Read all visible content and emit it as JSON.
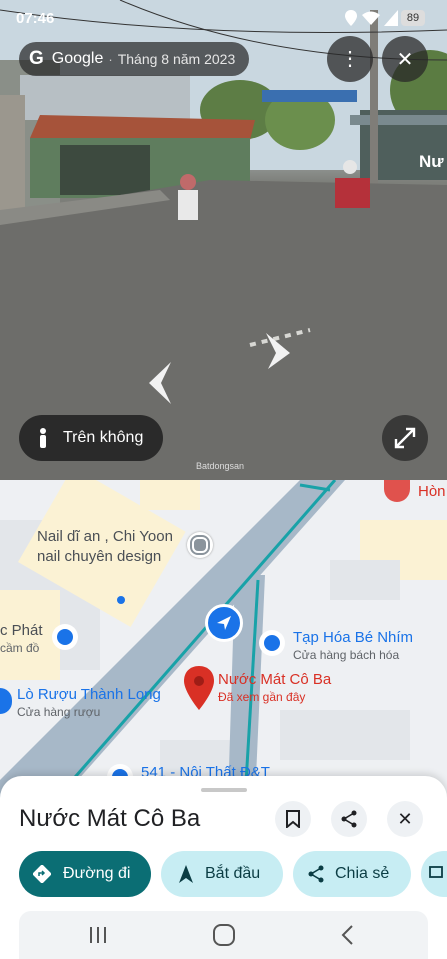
{
  "status": {
    "time": "07:46",
    "battery": "89"
  },
  "streetview": {
    "brand": "Google",
    "date": "Tháng 8 năm 2023",
    "mode_label": "Trên không",
    "sign_text": "Nư",
    "watermark": "Batdongsan"
  },
  "map": {
    "pois": [
      {
        "name": "Hòn",
        "sub": ""
      },
      {
        "name": "Nail dĩ an , Chi Yoon",
        "name2": "nail chuyên design"
      },
      {
        "name": "c Phát",
        "sub": "cầm đồ"
      },
      {
        "name": "Tạp Hóa Bé Nhím",
        "sub": "Cửa hàng bách hóa"
      },
      {
        "name": "Lò Rượu Thành Long",
        "sub": "Cửa hàng rượu"
      },
      {
        "name": "Nước Mát Cô Ba",
        "sub": "Đã xem gần đây"
      },
      {
        "name": "541 - Nội Thất Đ&T",
        "sub": ""
      }
    ]
  },
  "place": {
    "title": "Nước Mát Cô Ba",
    "actions": {
      "directions": "Đường đi",
      "start": "Bắt đầu",
      "share": "Chia sẻ"
    }
  },
  "colors": {
    "accent": "#0b6e74",
    "chip_bg": "#c7edf3",
    "pin": "#d93025",
    "road": "#a7b8c8",
    "route": "#19a2a8"
  }
}
